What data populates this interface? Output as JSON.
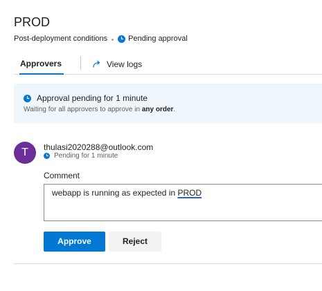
{
  "header": {
    "title": "PROD",
    "section": "Post-deployment conditions",
    "status": "Pending approval"
  },
  "tabs": [
    {
      "label": "Approvers",
      "selected": true
    },
    {
      "label": "View logs",
      "selected": false
    }
  ],
  "banner": {
    "heading": "Approval pending for 1 minute",
    "sub_prefix": "Waiting for all approvers to approve in ",
    "sub_emphasis": "any order",
    "sub_suffix": "."
  },
  "approver": {
    "initial": "T",
    "email": "thulasi2020288@outlook.com",
    "status": "Pending for 1 minute",
    "avatar_color": "#6b2e96"
  },
  "comment": {
    "label": "Comment",
    "value_prefix": "webapp is running as expected in ",
    "value_flagged_word": "PROD"
  },
  "actions": {
    "approve_label": "Approve",
    "reject_label": "Reject"
  },
  "icons": {
    "status": "clock-icon",
    "logs": "view-logs-arrow-icon"
  },
  "colors": {
    "accent": "#0078d4",
    "banner_bg": "#eff6fc",
    "text_secondary": "#605e5c"
  }
}
